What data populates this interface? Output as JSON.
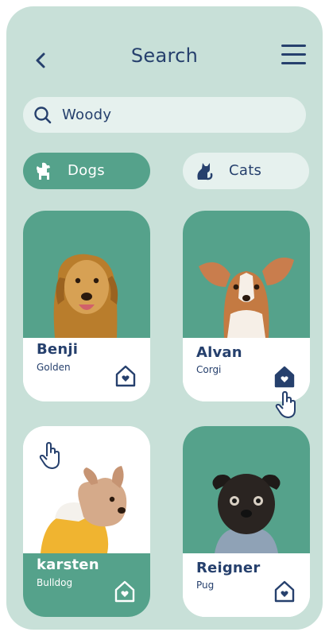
{
  "header": {
    "title": "Search",
    "back_icon": "chevron-left-icon",
    "menu_icon": "hamburger-menu-icon"
  },
  "search": {
    "value": "Woody",
    "icon": "search-icon"
  },
  "filters": [
    {
      "label": "Dogs",
      "icon": "dog-icon",
      "selected": true
    },
    {
      "label": "Cats",
      "icon": "cat-icon",
      "selected": false
    }
  ],
  "pets": [
    {
      "name": "Benji",
      "breed": "Golden"
    },
    {
      "name": "Alvan",
      "breed": "Corgi"
    },
    {
      "name": "karsten",
      "breed": "Bulldog"
    },
    {
      "name": "Reigner",
      "breed": "Pug"
    }
  ],
  "colors": {
    "background": "#c8e0d8",
    "accent": "#55a28b",
    "text": "#26406d",
    "field": "#e6f1ee"
  }
}
